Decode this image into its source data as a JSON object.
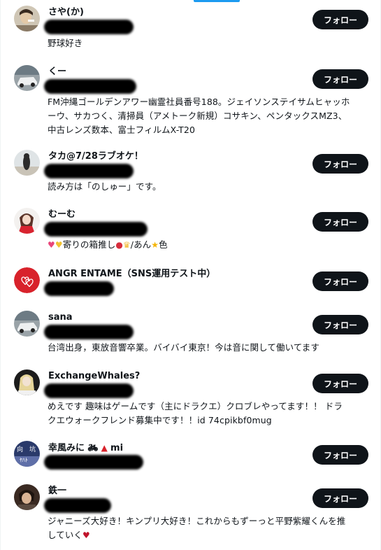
{
  "follow_label": "フォロー",
  "users": [
    {
      "name": "さや(か)",
      "bio_lines": [
        "野球好き"
      ],
      "avatar": "photo-person-smoking"
    },
    {
      "name": "くー",
      "bio_lines": [
        "FM沖縄ゴールデンアワー幽霊社員番号188。ジェイソンステイサムヒャッホ",
        "ーウ、サカつく、清掃員（アメトーク新規）コサキン、ペンタックスMZ3、",
        "中古レンズ数本、富士フィルムX-T20"
      ],
      "avatar": "photo-car"
    },
    {
      "name": "タカ@7/28ラブオケ！",
      "bio_lines": [
        "読み方は「のしゅー」です。"
      ],
      "avatar": "photo-person-beach"
    },
    {
      "name": "むーむ",
      "bio_lines": [
        "寄りの箱推し",
        "/あん",
        "色"
      ],
      "avatar": "illustration-girl"
    },
    {
      "name": "ANGR ENTAME（SNS運用テスト中）",
      "bio_lines": [],
      "avatar": "red-logo-hearts"
    },
    {
      "name": "sana",
      "bio_lines": [
        "台湾出身，東放音響卒業。バイバイ東京！今は音に関して働いてます"
      ],
      "avatar": "photo-car"
    },
    {
      "name": "ExchangeWhales?",
      "bio_lines": [
        "めえです 趣味はゲームです（主にドラクエ）クロブレやってます！！ ドラ",
        "クエウォークフレンド募集中です！！id 74cpikbf0mug"
      ],
      "avatar": "illustration-blonde"
    },
    {
      "name": "幸風みに",
      "name_suffix": "mi",
      "bio_lines": [],
      "avatar": "illustration-text-blue"
    },
    {
      "name": "鉄一",
      "bio_lines": [
        "ジャニーズ大好き！キンプリ大好き！これからもずーっと平野紫耀くんを推",
        "していく"
      ],
      "avatar": "photo-person-dark"
    }
  ],
  "colors": {
    "button_bg": "#0f1419",
    "accent": "#1d9bf0"
  }
}
